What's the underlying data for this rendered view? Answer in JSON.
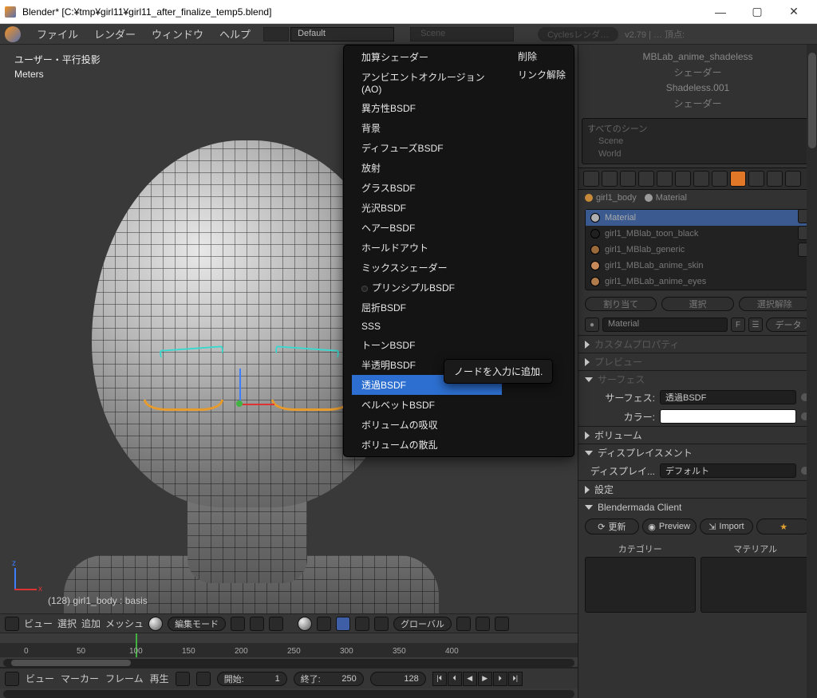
{
  "window": {
    "title": "Blender* [C:¥tmp¥girl11¥girl11_after_finalize_temp5.blend]"
  },
  "menubar": {
    "items": [
      "ファイル",
      "レンダー",
      "ウィンドウ",
      "ヘルプ"
    ],
    "layout": "Default",
    "scene_label": "Scene",
    "engine": "Cyclesレンダ…",
    "version": "v2.79 | … 頂点:"
  },
  "viewport": {
    "title": "ユーザー・平行投影",
    "units": "Meters",
    "axis_z": "z",
    "axis_x": "x",
    "object_label": "(128) girl1_body : basis",
    "toolbar": {
      "view": "ビュー",
      "select": "選択",
      "add": "追加",
      "mesh": "メッシュ",
      "mode": "編集モード",
      "orient": "グローバル"
    }
  },
  "timeline": {
    "ticks": [
      "0",
      "50",
      "100",
      "150",
      "200",
      "250",
      "300",
      "350",
      "400"
    ],
    "cursor_at": 128,
    "toolbar": {
      "view": "ビュー",
      "marker": "マーカー",
      "frame": "フレーム",
      "play": "再生",
      "start_label": "開始:",
      "start_val": "1",
      "end_label": "終了:",
      "end_val": "250",
      "cur_val": "128"
    }
  },
  "breadcrumb": {
    "material_label": "MBLab_anime_shadeless",
    "shader1": "シェーダー",
    "shadeless": "Shadeless.001",
    "shader2": "シェーダー"
  },
  "outliner": {
    "scene": "Scene",
    "items": [
      "すべてのシーン",
      "Scene",
      "World"
    ]
  },
  "props": {
    "crumb_obj": "girl1_body",
    "crumb_mat": "Material",
    "slots": [
      {
        "name": "Material",
        "color": "#b0b0b0"
      },
      {
        "name": "girl1_MBlab_toon_black",
        "color": "#202020"
      },
      {
        "name": "girl1_MBlab_generic",
        "color": "#9a6a3a"
      },
      {
        "name": "girl1_MBLab_anime_skin",
        "color": "#c98a5a"
      },
      {
        "name": "girl1_MBLab_anime_eyes",
        "color": "#b07b4a"
      }
    ],
    "assign": "割り当て",
    "select": "選択",
    "deselect": "選択解除",
    "mat_field": "Material",
    "f": "F",
    "data_btn": "データ",
    "panels": {
      "custom": "カスタムプロパティ",
      "preview": "プレビュー",
      "surface": "サーフェス",
      "surface_type_label": "サーフェス:",
      "surface_type_value": "透過BSDF",
      "color_label": "カラー:",
      "volume": "ボリューム",
      "displacement": "ディスプレイスメント",
      "disp_label": "ディスプレイ...",
      "disp_value": "デフォルト",
      "settings": "設定",
      "bclient": "Blendermada Client",
      "refresh": "更新",
      "preview_btn": "Preview",
      "import": "Import",
      "category": "カテゴリー",
      "material": "マテリアル"
    }
  },
  "menu": {
    "remove": "削除",
    "unlink": "リンク解除",
    "items": [
      "加算シェーダー",
      "アンビエントオクルージョン(AO)",
      "異方性BSDF",
      "背景",
      "ディフューズBSDF",
      "放射",
      "グラスBSDF",
      "光沢BSDF",
      "ヘアーBSDF",
      "ホールドアウト",
      "ミックスシェーダー",
      "プリンシプルBSDF",
      "屈折BSDF",
      "SSS",
      "トーンBSDF",
      "半透明BSDF",
      "透過BSDF",
      "ベルベットBSDF",
      "ボリュームの吸収",
      "ボリュームの散乱"
    ],
    "selected_index": 16,
    "tooltip": "ノードを入力に追加."
  }
}
